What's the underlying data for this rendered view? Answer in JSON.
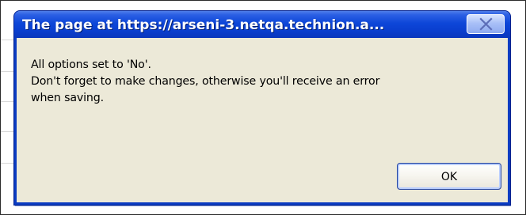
{
  "dialog": {
    "title": "The page at https://arseni-3.netqa.technion.a...",
    "close_icon": "close-icon",
    "message_lines": [
      "All options set to 'No'.",
      "Don't forget to make changes, otherwise you'll receive an error",
      "when saving."
    ],
    "ok_label": "OK"
  },
  "colors": {
    "titlebar": "#0A3FD0",
    "dialog_background": "#ECE9D8",
    "border": "#0B3CC2"
  }
}
